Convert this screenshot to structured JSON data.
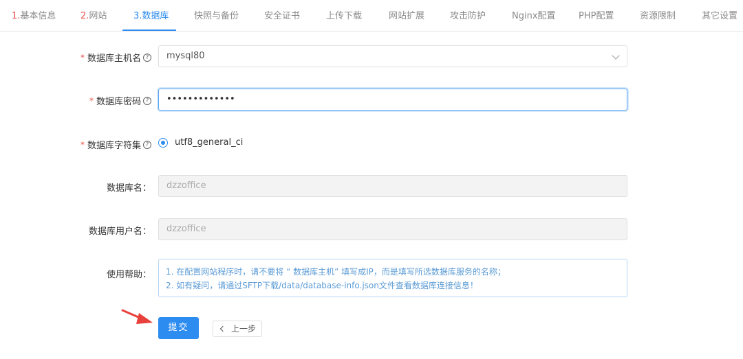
{
  "tabs": [
    {
      "num": "1.",
      "label": "基本信息"
    },
    {
      "num": "2.",
      "label": "网站"
    },
    {
      "num": "3.",
      "label": "数据库"
    },
    {
      "num": "",
      "label": "快照与备份"
    },
    {
      "num": "",
      "label": "安全证书"
    },
    {
      "num": "",
      "label": "上传下载"
    },
    {
      "num": "",
      "label": "网站扩展"
    },
    {
      "num": "",
      "label": "攻击防护"
    },
    {
      "num": "",
      "label": "Nginx配置"
    },
    {
      "num": "",
      "label": "PHP配置"
    },
    {
      "num": "",
      "label": "资源限制"
    },
    {
      "num": "",
      "label": "其它设置"
    }
  ],
  "active_tab": "数据库",
  "form": {
    "required_mark": "*",
    "help_mark": "?",
    "db_host": {
      "label": "数据库主机名",
      "value": "mysql80"
    },
    "db_password": {
      "label": "数据库密码",
      "value": "•••••••••••••"
    },
    "db_charset": {
      "label": "数据库字符集",
      "value": "utf8_general_ci"
    },
    "db_name": {
      "label": "数据库名：",
      "value": "dzzoffice"
    },
    "db_user": {
      "label": "数据库用户名：",
      "value": "dzzoffice"
    },
    "help": {
      "label": "使用帮助：",
      "lines": [
        "1. 在配置网站程序时，请不要将 “ 数据库主机” 填写成IP，而是填写所选数据库服务的名称；",
        "2. 如有疑问，请通过SFTP下载/data/database-info.json文件查看数据库连接信息！"
      ]
    }
  },
  "buttons": {
    "submit": "提交",
    "back": "上一步"
  },
  "colors": {
    "accent": "#2d8cf0",
    "required": "#e8534a",
    "arrow": "#e8403a"
  }
}
